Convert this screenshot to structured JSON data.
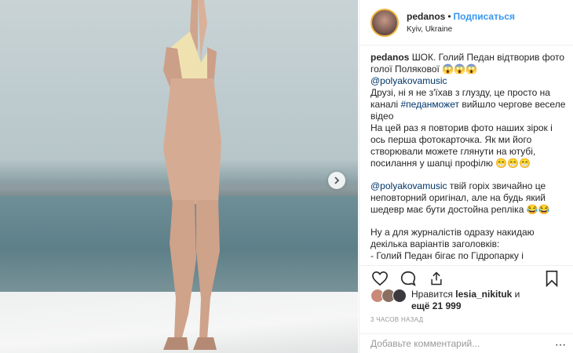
{
  "post": {
    "username": "pedanos",
    "follow_label": "Подписаться",
    "location": "Kyiv, Ukraine",
    "separator": "•"
  },
  "caption": {
    "author": "pedanos",
    "line1": "ШОК. Голий Педан відтворив фото голої Полякової 😱😱😱",
    "mention1": "@polyakovamusic",
    "p2_a": "Друзі, ні я не з'їхав з глузду, це просто на каналі ",
    "hashtag": "#педанможет",
    "p2_b": " вийшло чергове веселе відео",
    "p3": "На цей раз я повторив фото наших зірок і ось перша фотокарточка. Як ми його створювали можете глянути на ютубі, посилання у шапці профілю 😁😁😁",
    "mention2": "@polyakovamusic",
    "p4": " твій горіх звичайно це неповторний оригінал, але на будь який шедевр має бути достойна репліка 😂😂",
    "p5": "Ну а для журналістів одразу накидаю декілька варіантів заголовків:",
    "p6": "- Голий Педан бігає по Гідропарку і"
  },
  "likes": {
    "text_prefix": "Нравится ",
    "top_liker": "lesia_nikituk",
    "text_mid": " и",
    "count_text": "ещё 21 999"
  },
  "timestamp": "3 ЧАСОВ НАЗАД",
  "comment_input": {
    "placeholder": "Добавьте комментарий...",
    "more": "⋯"
  },
  "icons": {
    "like": "heart-icon",
    "comment": "comment-icon",
    "share": "share-icon",
    "save": "bookmark-icon",
    "next": "chevron-right-icon"
  },
  "colors": {
    "link": "#003569",
    "follow": "#3897f0",
    "story_ring": "#f0b640"
  }
}
